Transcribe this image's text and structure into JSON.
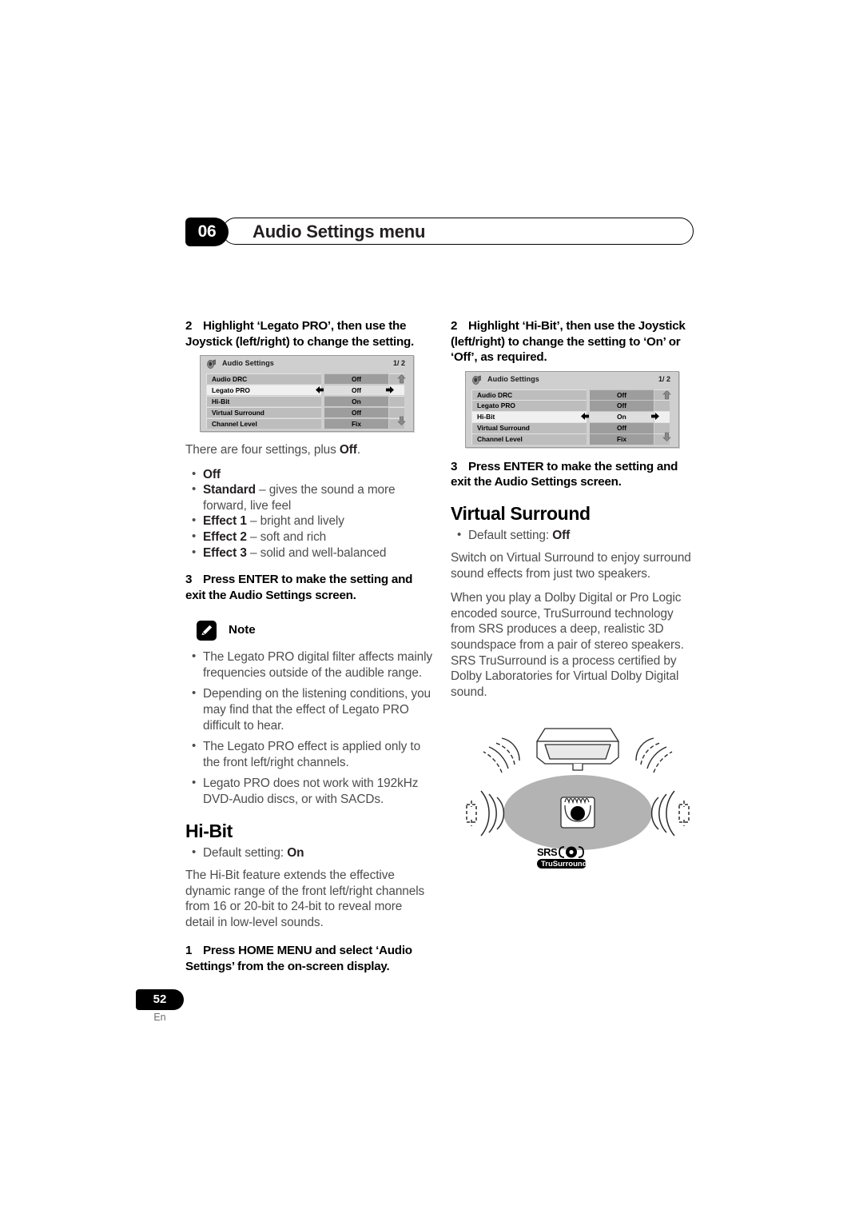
{
  "header": {
    "chapter_number": "06",
    "title": "Audio Settings menu"
  },
  "left_column": {
    "step2": {
      "num": "2",
      "text": "Highlight ‘Legato PRO’, then use the Joystick (left/right) to change the setting."
    },
    "osd": {
      "title": "Audio Settings",
      "page_indicator": "1/ 2",
      "title_icon": "speaker-note-icon",
      "selected_row": "Legato PRO",
      "rows": [
        {
          "label": "Audio DRC",
          "value": "Off"
        },
        {
          "label": "Legato PRO",
          "value": "Off"
        },
        {
          "label": "Hi-Bit",
          "value": "On"
        },
        {
          "label": "Virtual Surround",
          "value": "Off"
        },
        {
          "label": "Channel Level",
          "value": "Fix"
        }
      ]
    },
    "intro": "There are four settings, plus ",
    "intro_bold": "Off",
    "intro_tail": ".",
    "settings": [
      {
        "name": "Off",
        "desc": ""
      },
      {
        "name": "Standard",
        "desc": " – gives the sound a more forward, live feel"
      },
      {
        "name": "Effect 1",
        "desc": " – bright and lively"
      },
      {
        "name": "Effect 2",
        "desc": " – soft and rich"
      },
      {
        "name": "Effect 3",
        "desc": " – solid and well-balanced"
      }
    ],
    "step3": {
      "num": "3",
      "text": "Press ENTER to make the setting and exit the Audio Settings screen."
    },
    "note": {
      "label": "Note",
      "icon": "pencil-icon",
      "items": [
        "The Legato PRO digital filter affects mainly frequencies outside of the audible range.",
        "Depending on the listening conditions, you may find that the effect of Legato PRO difficult to hear.",
        "The Legato PRO effect is applied only to the front left/right channels.",
        "Legato PRO does not work with 192kHz DVD-Audio discs, or with SACDs."
      ]
    },
    "hibit": {
      "heading": "Hi-Bit",
      "default_prefix": "Default setting: ",
      "default_value": "On",
      "body": "The Hi-Bit feature extends the effective dynamic range of the front left/right channels from 16 or 20-bit to 24-bit to reveal more detail in low-level sounds.",
      "step1": {
        "num": "1",
        "text": "Press HOME MENU and select ‘Audio Settings’ from the on-screen display."
      }
    }
  },
  "right_column": {
    "step2": {
      "num": "2",
      "text": "Highlight ‘Hi-Bit’, then use the Joystick (left/right) to change the setting to ‘On’ or ‘Off’, as required."
    },
    "osd": {
      "title": "Audio Settings",
      "page_indicator": "1/ 2",
      "title_icon": "speaker-note-icon",
      "selected_row": "Hi-Bit",
      "rows": [
        {
          "label": "Audio DRC",
          "value": "Off"
        },
        {
          "label": "Legato PRO",
          "value": "Off"
        },
        {
          "label": "Hi-Bit",
          "value": "On"
        },
        {
          "label": "Virtual Surround",
          "value": "Off"
        },
        {
          "label": "Channel Level",
          "value": "Fix"
        }
      ]
    },
    "step3": {
      "num": "3",
      "text": "Press ENTER to make the setting and exit the Audio Settings screen."
    },
    "virtual_surround": {
      "heading": "Virtual Surround",
      "default_prefix": "Default setting: ",
      "default_value": "Off",
      "paragraph1": "Switch on Virtual Surround to enjoy surround sound effects from just two speakers.",
      "paragraph2": "When you play a Dolby Digital or Pro Logic encoded source, TruSurround technology from SRS produces a deep, realistic 3D soundspace from a pair of stereo speakers. SRS TruSurround is a process certified by Dolby Laboratories for Virtual Dolby Digital sound.",
      "figure": {
        "name": "virtual-surround-diagram",
        "logo_primary": "SRS",
        "logo_secondary": "TruSurround"
      }
    }
  },
  "footer": {
    "page_number": "52",
    "language": "En"
  }
}
